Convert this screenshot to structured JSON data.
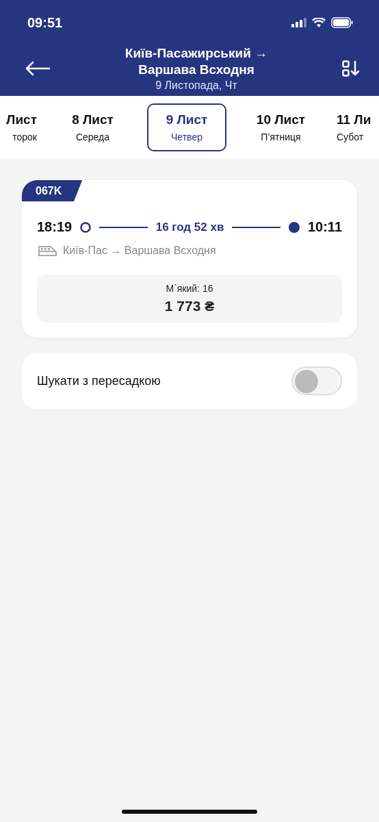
{
  "status_bar": {
    "time": "09:51"
  },
  "header": {
    "title": "Київ-Пасажирський → Варшава Всходня",
    "subtitle": "9 Листопада, Чт"
  },
  "dates": [
    {
      "day": "Лист",
      "weekday": "торок",
      "selected": false
    },
    {
      "day": "8 Лист",
      "weekday": "Середа",
      "selected": false
    },
    {
      "day": "9 Лист",
      "weekday": "Четвер",
      "selected": true
    },
    {
      "day": "10 Лист",
      "weekday": "П’ятниця",
      "selected": false
    },
    {
      "day": "11 Ли",
      "weekday": "Субот",
      "selected": false
    }
  ],
  "trains": [
    {
      "number": "067K",
      "departure": "18:19",
      "duration": "16 год 52 хв",
      "arrival": "10:11",
      "route": "Київ-Пас → Варшава Всходня",
      "seat_class": "М`який: 16",
      "price": "1 773 ₴"
    }
  ],
  "transfer": {
    "label": "Шукати з пересадкою",
    "on": false
  }
}
